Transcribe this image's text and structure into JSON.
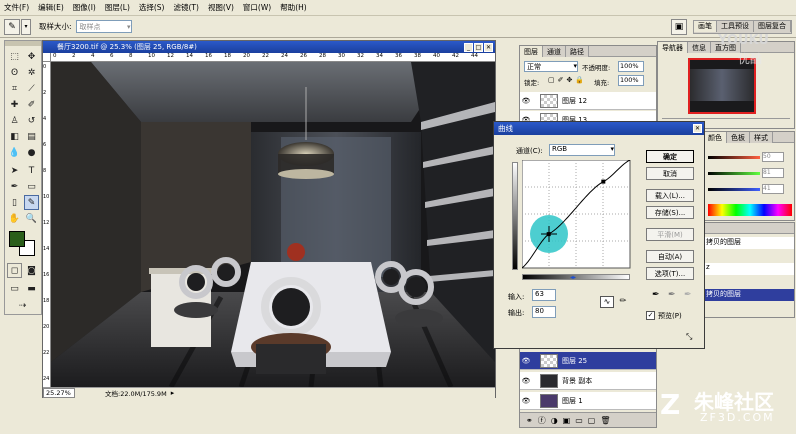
{
  "menu": [
    "文件(F)",
    "编辑(E)",
    "图像(I)",
    "图层(L)",
    "选择(S)",
    "滤镜(T)",
    "视图(V)",
    "窗口(W)",
    "帮助(H)"
  ],
  "options": {
    "sample_label": "取样大小:",
    "sample_value": "取样点"
  },
  "panel_tabs_top": [
    "画笔",
    "工具预设",
    "图层复合"
  ],
  "document": {
    "title": "餐厅3200.tif @ 25.3% (图层 25, RGB/8#)",
    "zoom": "25.27%",
    "doc_size": "文档:22.0M/175.9M",
    "ruler_marks": [
      "0",
      "2",
      "4",
      "6",
      "8",
      "10",
      "12",
      "14",
      "16",
      "18",
      "20",
      "22",
      "24",
      "26",
      "28",
      "30",
      "32",
      "34",
      "36",
      "38",
      "40",
      "42",
      "44"
    ],
    "ruler_left_marks": [
      "0",
      "2",
      "4",
      "6",
      "8",
      "10",
      "12",
      "14",
      "16",
      "18",
      "20",
      "22",
      "24"
    ]
  },
  "layers_panel": {
    "tabs": [
      "图层",
      "通道",
      "路径"
    ],
    "blend_mode": "正常",
    "opacity_label": "不透明度:",
    "opacity_value": "100%",
    "lock_label": "锁定:",
    "fill_label": "填充:",
    "fill_value": "100%",
    "layers_top": [
      {
        "name": "图层 12"
      },
      {
        "name": "图层 13"
      }
    ],
    "layers_bottom": [
      {
        "name": "图层 25"
      },
      {
        "name": "背景 副本"
      },
      {
        "name": "图层 1"
      }
    ]
  },
  "navigator": {
    "tabs": [
      "导航器",
      "信息",
      "直方图"
    ]
  },
  "color_panel": {
    "tabs": [
      "颜色",
      "色板",
      "样式"
    ],
    "values": [
      "50",
      "81",
      "41"
    ]
  },
  "history_panel": {
    "items": [
      "拷贝的图层",
      "拷贝的图层"
    ],
    "item_fragment": "z"
  },
  "curves": {
    "title": "曲线",
    "channel_label": "通道(C):",
    "channel_value": "RGB",
    "buttons": [
      "确定",
      "取消",
      "载入(L)...",
      "存储(S)...",
      "平滑(M)",
      "自动(A)",
      "选项(T)..."
    ],
    "input_label": "输入:",
    "input_value": "63",
    "output_label": "输出:",
    "output_value": "80",
    "preview_label": "预览(P)",
    "preview_checked": true,
    "curve_points": [
      [
        0,
        0
      ],
      [
        63,
        80
      ],
      [
        192,
        204
      ],
      [
        255,
        255
      ]
    ]
  },
  "watermark": {
    "brand_cn": "朱峰社区",
    "brand_en": "ZF3D.COM",
    "youku": "YOUKU",
    "youku_cn": "优酷"
  },
  "colors": {
    "foreground": "#2a5e1a",
    "background": "#ffffff",
    "titlebar": "#2b59c9",
    "accent_cyan": "#2ec6c8"
  }
}
